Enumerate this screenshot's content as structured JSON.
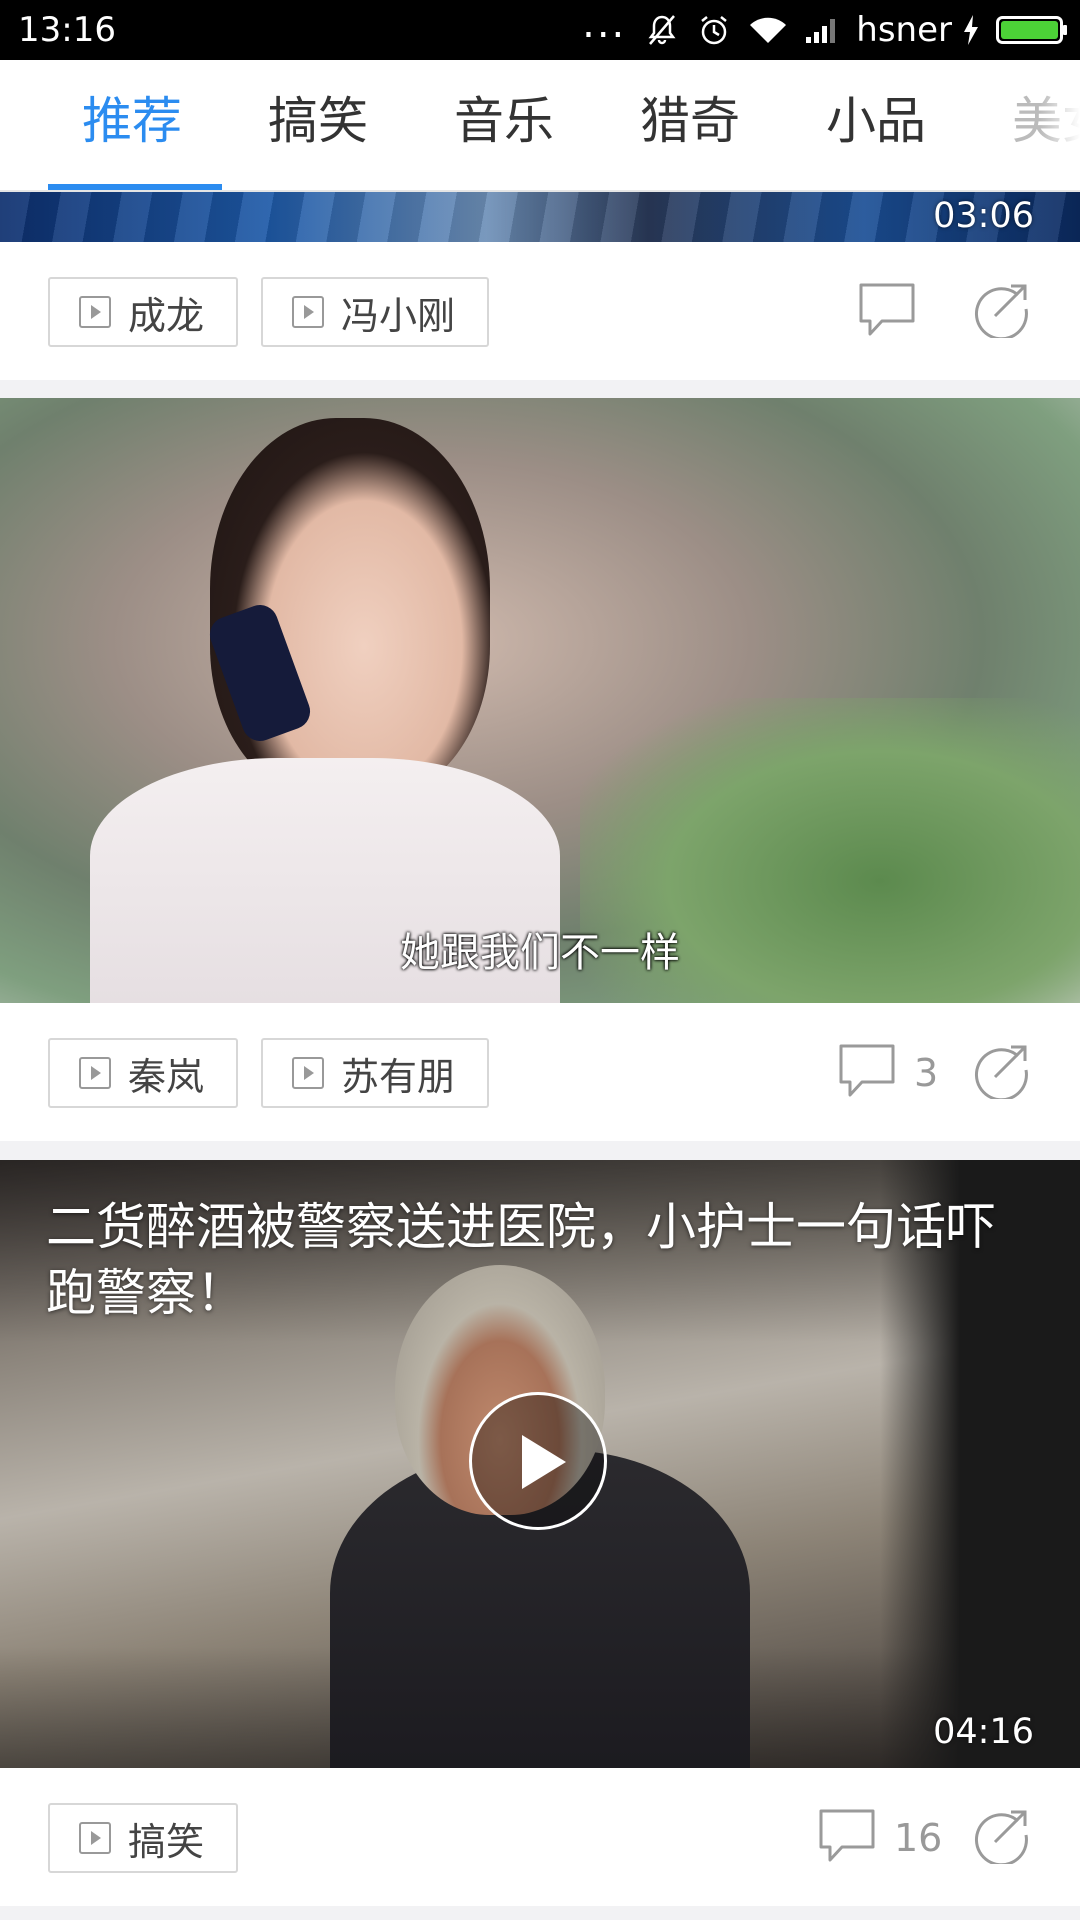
{
  "status_bar": {
    "time": "13:16",
    "dots": "...",
    "carrier": "hsner",
    "icons": [
      "mute-icon",
      "alarm-icon",
      "wifi-icon",
      "signal-icon",
      "charging-icon",
      "battery-icon"
    ]
  },
  "tabs": [
    {
      "label": "推荐",
      "active": true
    },
    {
      "label": "搞笑",
      "active": false
    },
    {
      "label": "音乐",
      "active": false
    },
    {
      "label": "猎奇",
      "active": false
    },
    {
      "label": "小品",
      "active": false
    },
    {
      "label": "美女",
      "active": false
    }
  ],
  "feed": [
    {
      "duration": "03:06",
      "tags": [
        "成龙",
        "冯小刚"
      ],
      "comment_count": ""
    },
    {
      "subtitle": "她跟我们不一样",
      "tags": [
        "秦岚",
        "苏有朋"
      ],
      "comment_count": "3"
    },
    {
      "title": "二货醉酒被警察送进医院，小护士一句话吓跑警察！",
      "duration": "04:16",
      "tags": [
        "搞笑"
      ],
      "comment_count": "16"
    }
  ],
  "colors": {
    "accent": "#2b8cf0",
    "status_bar_bg": "#000000",
    "feed_bg": "#f2f2f4",
    "battery": "#4cd137"
  }
}
